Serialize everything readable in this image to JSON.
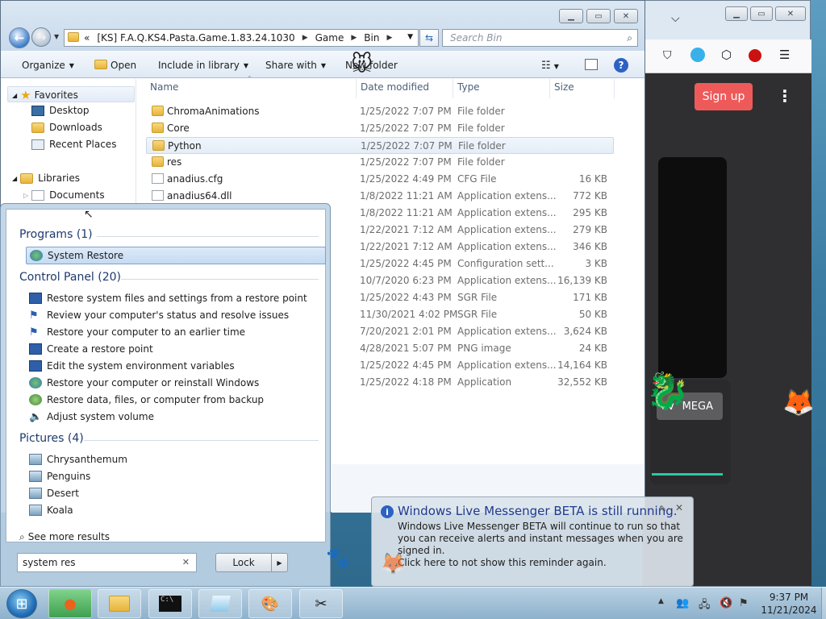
{
  "browser": {
    "signup_label": "Sign up",
    "menu_icon": "kebab-icon",
    "partial_button_label": "MEGA",
    "partial_button_prefix": "av"
  },
  "explorer": {
    "breadcrumb": {
      "prefix": "«",
      "segments": [
        "[KS] F.A.Q.KS4.Pasta.Game.1.83.24.1030",
        "Game",
        "Bin"
      ]
    },
    "search_placeholder": "Search Bin",
    "toolbar": {
      "organize": "Organize",
      "open": "Open",
      "include_in_library": "Include in library",
      "share_with": "Share with",
      "new_folder": "New folder"
    },
    "nav": {
      "favorites": "Favorites",
      "desktop": "Desktop",
      "downloads": "Downloads",
      "recent_places": "Recent Places",
      "libraries": "Libraries",
      "documents": "Documents"
    },
    "columns": {
      "name": "Name",
      "date_modified": "Date modified",
      "type": "Type",
      "size": "Size"
    },
    "files": [
      {
        "name": "ChromaAnimations",
        "date": "1/25/2022 7:07 PM",
        "type": "File folder",
        "size": "",
        "kind": "folder"
      },
      {
        "name": "Core",
        "date": "1/25/2022 7:07 PM",
        "type": "File folder",
        "size": "",
        "kind": "folder"
      },
      {
        "name": "Python",
        "date": "1/25/2022 7:07 PM",
        "type": "File folder",
        "size": "",
        "kind": "folder"
      },
      {
        "name": "res",
        "date": "1/25/2022 7:07 PM",
        "type": "File folder",
        "size": "",
        "kind": "folder"
      },
      {
        "name": "anadius.cfg",
        "date": "1/25/2022 4:49 PM",
        "type": "CFG File",
        "size": "16 KB",
        "kind": "doc"
      },
      {
        "name": "anadius64.dll",
        "date": "1/8/2022 11:21 AM",
        "type": "Application extens...",
        "size": "772 KB",
        "kind": "doc"
      },
      {
        "name": "",
        "date": "1/8/2022 11:21 AM",
        "type": "Application extens...",
        "size": "295 KB",
        "kind": "none"
      },
      {
        "name": "",
        "date": "1/22/2021 7:12 AM",
        "type": "Application extens...",
        "size": "279 KB",
        "kind": "none"
      },
      {
        "name": "",
        "date": "1/22/2021 7:12 AM",
        "type": "Application extens...",
        "size": "346 KB",
        "kind": "none"
      },
      {
        "name": "",
        "date": "1/25/2022 4:45 PM",
        "type": "Configuration sett...",
        "size": "3 KB",
        "kind": "none"
      },
      {
        "name": "",
        "date": "10/7/2020 6:23 PM",
        "type": "Application extens...",
        "size": "16,139 KB",
        "kind": "none"
      },
      {
        "name": "",
        "date": "1/25/2022 4:43 PM",
        "type": "SGR File",
        "size": "171 KB",
        "kind": "none"
      },
      {
        "name": "",
        "date": "11/30/2021 4:02 PM",
        "type": "SGR File",
        "size": "50 KB",
        "kind": "none"
      },
      {
        "name": "",
        "date": "7/20/2021 2:01 PM",
        "type": "Application extens...",
        "size": "3,624 KB",
        "kind": "none"
      },
      {
        "name": "",
        "date": "4/28/2021 5:07 PM",
        "type": "PNG image",
        "size": "24 KB",
        "kind": "none"
      },
      {
        "name": "",
        "date": "1/25/2022 4:45 PM",
        "type": "Application extens...",
        "size": "14,164 KB",
        "kind": "none"
      },
      {
        "name": "",
        "date": "1/25/2022 4:18 PM",
        "type": "Application",
        "size": "32,552 KB",
        "kind": "none"
      }
    ]
  },
  "start_menu": {
    "programs_header": "Programs (1)",
    "programs": [
      "System Restore"
    ],
    "control_panel_header": "Control Panel (20)",
    "control_panel": [
      "Restore system files and settings from a restore point",
      "Review your computer's status and resolve issues",
      "Restore your computer to an earlier time",
      "Create a restore point",
      "Edit the system environment variables",
      "Restore your computer or reinstall Windows",
      "Restore data, files, or computer from backup",
      "Adjust system volume"
    ],
    "pictures_header": "Pictures (4)",
    "pictures": [
      "Chrysanthemum",
      "Penguins",
      "Desert",
      "Koala"
    ],
    "see_more": "See more results",
    "search_value": "system res",
    "lock_label": "Lock"
  },
  "toast": {
    "title": "Windows Live Messenger BETA is still running.",
    "body": "Windows Live Messenger BETA will continue to run so that you can receive alerts and instant messages when you are signed in.",
    "click_here": "Click here to not show this reminder again."
  },
  "taskbar": {
    "time": "9:37 PM",
    "date": "11/21/2024"
  }
}
